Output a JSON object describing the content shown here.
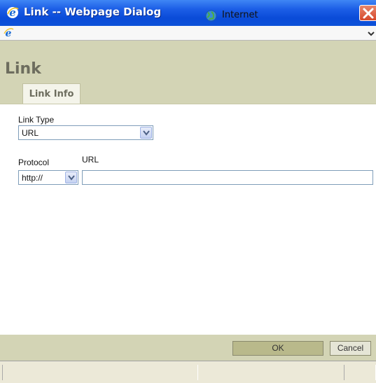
{
  "window": {
    "title": "Link -- Webpage Dialog",
    "browser_icon": "ie-icon",
    "close_icon": "close-icon"
  },
  "address_bar": {
    "icon": "ie-icon",
    "dropdown_icon": "chevron-down-icon"
  },
  "dialog": {
    "title": "Link",
    "tabs": [
      {
        "label": "Link Info",
        "active": true
      }
    ]
  },
  "form": {
    "link_type": {
      "label": "Link Type",
      "value": "URL"
    },
    "protocol": {
      "label": "Protocol",
      "value": "http://"
    },
    "url": {
      "label": "URL",
      "value": ""
    }
  },
  "footer": {
    "ok_label": "OK",
    "cancel_label": "Cancel"
  },
  "status_bar": {
    "zone_icon": "globe-icon",
    "zone_text": "Internet"
  },
  "colors": {
    "title_bar": "#0a4bd8",
    "dialog_chrome": "#d3d4b5",
    "tab_background": "#f4f4ea",
    "ok_button": "#b9b98b",
    "status_bar": "#ece9d8"
  }
}
